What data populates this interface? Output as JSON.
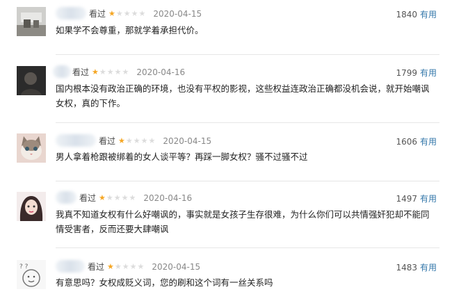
{
  "reviews": [
    {
      "seen_label": "看过",
      "rating": 1,
      "date": "2020-04-15",
      "votes": "1840",
      "useful_label": "有用",
      "content": "如果学不会尊重，那就学着承担代价。"
    },
    {
      "seen_label": "看过",
      "rating": 1,
      "date": "2020-04-16",
      "votes": "1799",
      "useful_label": "有用",
      "content": "国内根本没有政治正确的环境，也没有平权的影视，这些权益连政治正确都没机会说，就开始嘲讽女权，真的下作。"
    },
    {
      "seen_label": "看过",
      "rating": 1,
      "date": "2020-04-15",
      "votes": "1606",
      "useful_label": "有用",
      "content": "男人拿着枪跟被绑着的女人谈平等？再踩一脚女权？骚不过骚不过"
    },
    {
      "seen_label": "看过",
      "rating": 1,
      "date": "2020-04-16",
      "votes": "1497",
      "useful_label": "有用",
      "content": "我真不知道女权有什么好嘲讽的，事实就是女孩子生存很难，为什么你们可以共情强奸犯却不能同情受害者，反而还要大肆嘲讽"
    },
    {
      "seen_label": "看过",
      "rating": 1,
      "date": "2020-04-15",
      "votes": "1483",
      "useful_label": "有用",
      "content": "有意思吗？女权成贬义词，您的刷和这个词有一丝关系吗"
    }
  ],
  "colors": {
    "star": "#f5a623",
    "useful_link": "#3377aa",
    "date": "#888888"
  },
  "icons": {
    "star_filled": "star-icon",
    "star_empty": "star-empty-icon"
  }
}
